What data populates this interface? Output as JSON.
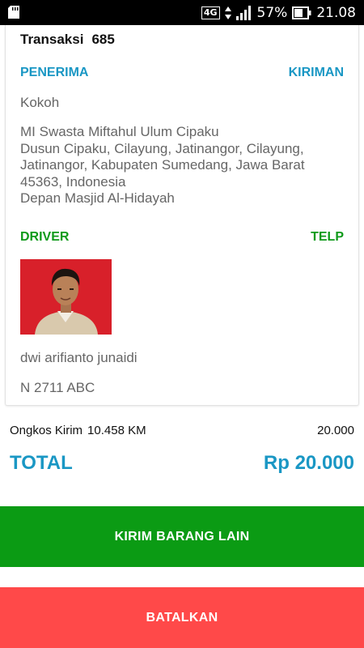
{
  "status_bar": {
    "network": "4G",
    "battery": "57%",
    "time": "21.08"
  },
  "transaction": {
    "label": "Transaksi",
    "number": "685"
  },
  "recipient": {
    "header_left": "PENERIMA",
    "header_right": "KIRIMAN",
    "name": "Kokoh",
    "address_lines": [
      "MI Swasta Miftahul Ulum Cipaku",
      "Dusun Cipaku, Cilayung, Jatinangor, Cilayung,",
      "Jatinangor, Kabupaten Sumedang, Jawa Barat",
      "45363, Indonesia",
      "Depan Masjid Al-Hidayah"
    ]
  },
  "driver": {
    "header_left": "DRIVER",
    "header_right": "TELP",
    "name": "dwi arifianto junaidi",
    "plate": "N 2711 ABC"
  },
  "summary": {
    "ongkos_label": "Ongkos Kirim",
    "distance": "10.458 KM",
    "ongkos_value": "20.000",
    "total_label": "TOTAL",
    "total_value": "Rp 20.000"
  },
  "buttons": {
    "send_other": "KIRIM BARANG LAIN",
    "cancel": "BATALKAN"
  },
  "colors": {
    "accent_blue": "#1a97c4",
    "accent_green": "#0f9a1a",
    "button_green": "#0b9b14",
    "button_red": "#ff4949"
  }
}
